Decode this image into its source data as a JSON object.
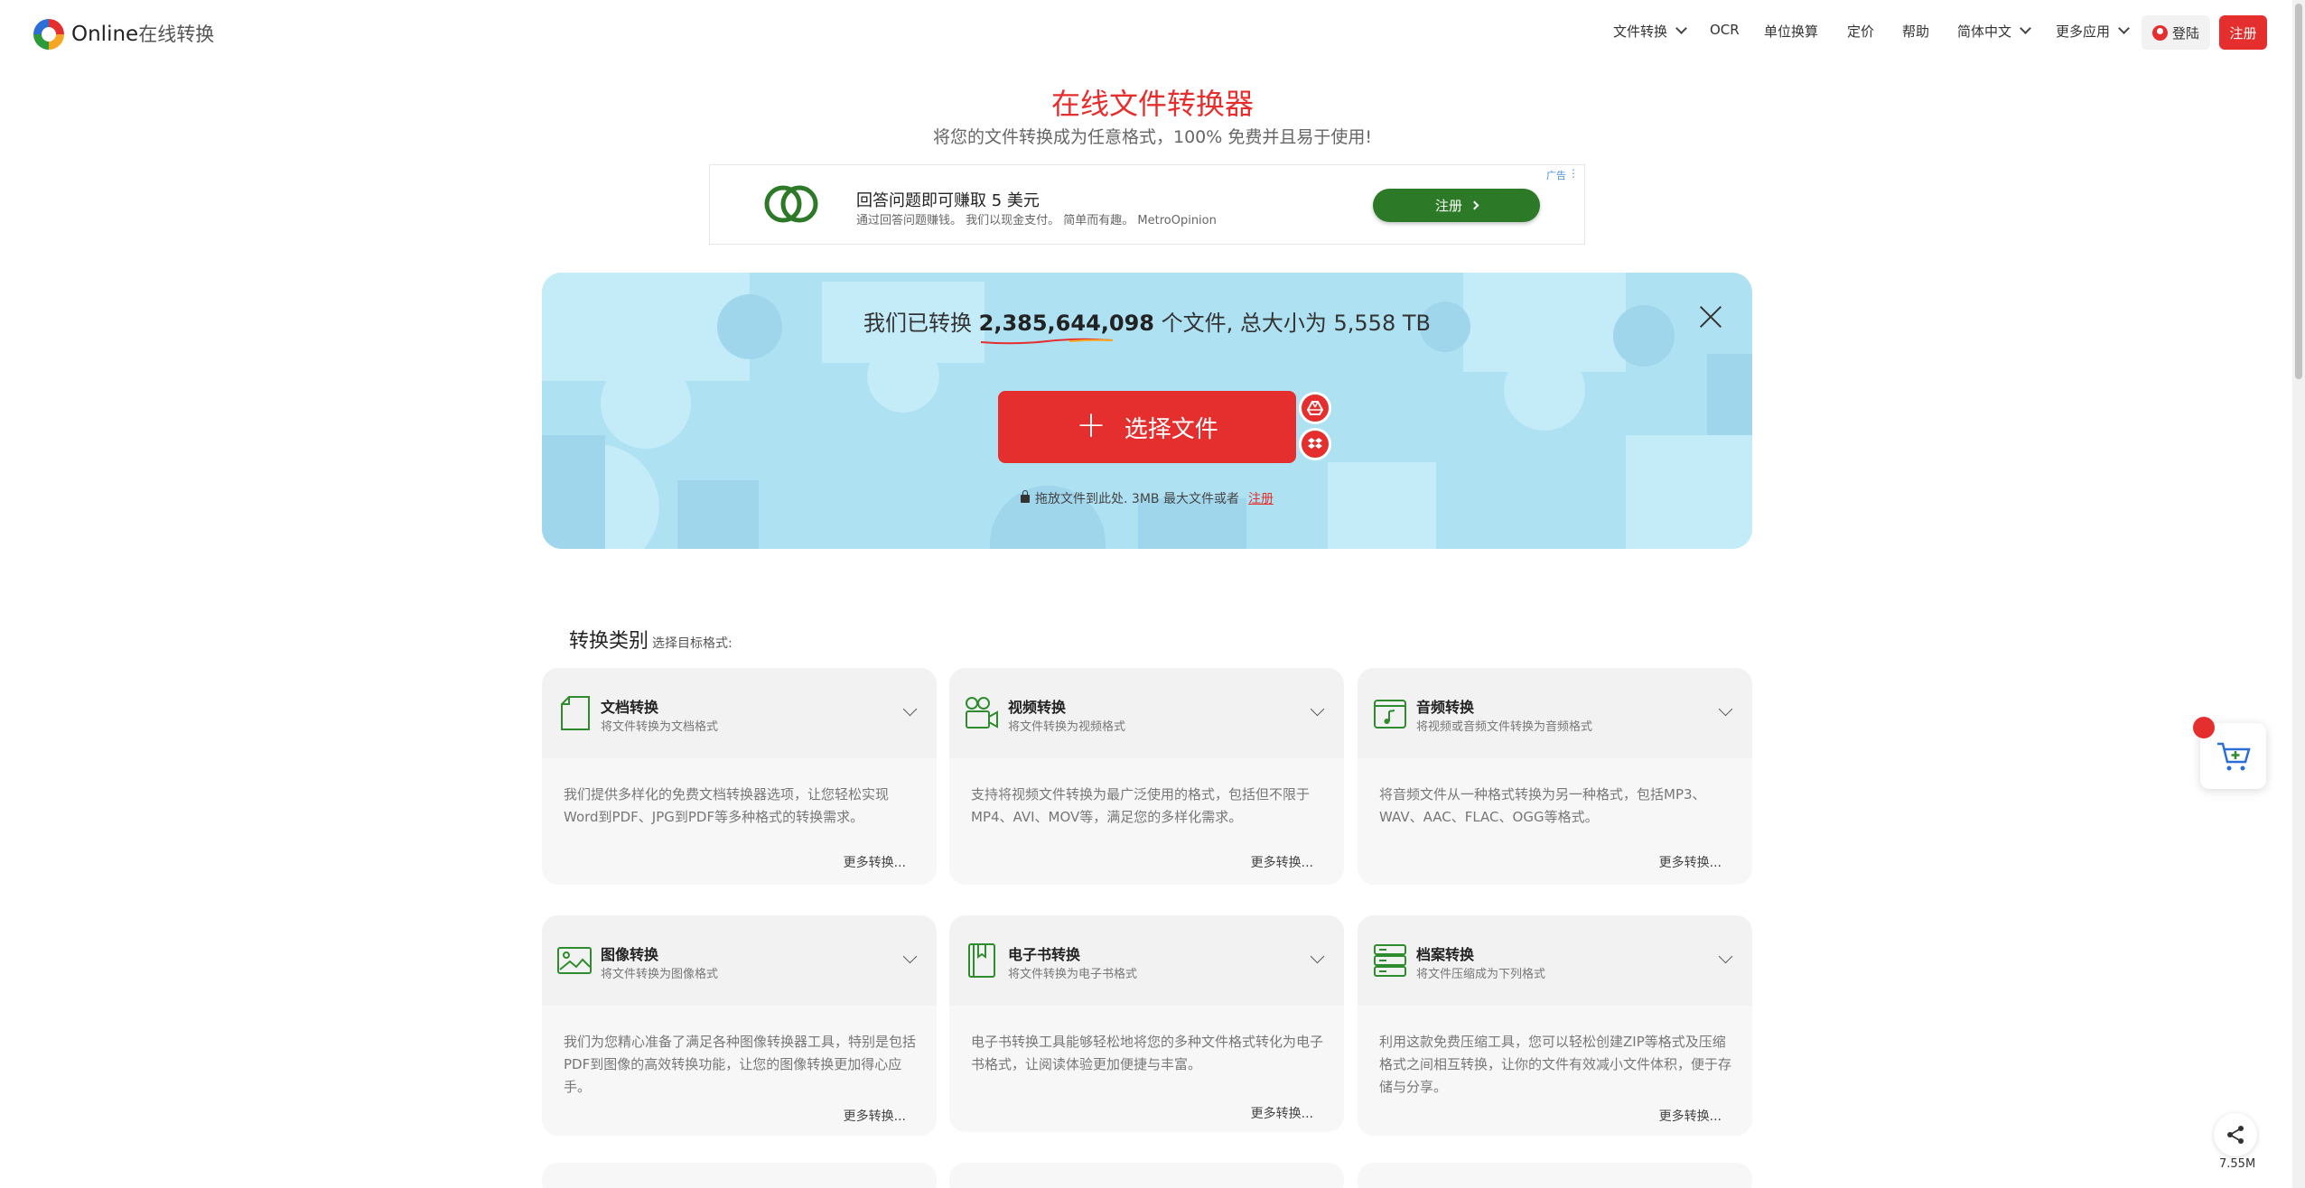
{
  "header": {
    "brand_main": "Online",
    "brand_sub": "在线转换",
    "nav": {
      "file_convert": "文件转换",
      "ocr": "OCR",
      "unit": "单位换算",
      "pricing": "定价",
      "help": "帮助",
      "language": "简体中文",
      "more_apps": "更多应用"
    },
    "login": "登陆",
    "register": "注册"
  },
  "hero": {
    "title": "在线文件转换器",
    "subtitle": "将您的文件转换成为任意格式，100% 免费并且易于使用!"
  },
  "ad": {
    "title": "回答问题即可赚取 5 美元",
    "desc": "通过回答问题赚钱。 我们以现金支付。 简单而有趣。 MetroOpinion",
    "button": "注册",
    "label": "广告"
  },
  "upload": {
    "stats_prefix": "我们已转换",
    "count": "2,385,644,098",
    "stats_suffix": "个文件, 总大小为 5,558 TB",
    "choose_button": "选择文件",
    "hint_text": "拖放文件到此处. 3MB 最大文件或者",
    "hint_link": "注册"
  },
  "categories": {
    "heading": "转换类别",
    "heading_small": "选择目标格式:",
    "more_label": "更多转换...",
    "items": [
      {
        "title": "文档转换",
        "sub": "将文件转换为文档格式",
        "desc": "我们提供多样化的免费文档转换器选项，让您轻松实现Word到PDF、JPG到PDF等多种格式的转换需求。"
      },
      {
        "title": "视频转换",
        "sub": "将文件转换为视频格式",
        "desc": "支持将视频文件转换为最广泛使用的格式，包括但不限于MP4、AVI、MOV等，满足您的多样化需求。"
      },
      {
        "title": "音频转换",
        "sub": "将视频或音频文件转换为音频格式",
        "desc": "将音频文件从一种格式转换为另一种格式，包括MP3、WAV、AAC、FLAC、OGG等格式。"
      },
      {
        "title": "图像转换",
        "sub": "将文件转换为图像格式",
        "desc": "我们为您精心准备了满足各种图像转换器工具，特别是包括PDF到图像的高效转换功能，让您的图像转换更加得心应手。"
      },
      {
        "title": "电子书转换",
        "sub": "将文件转换为电子书格式",
        "desc": "电子书转换工具能够轻松地将您的多种文件格式转化为电子书格式，让阅读体验更加便捷与丰富。"
      },
      {
        "title": "档案转换",
        "sub": "将文件压缩成为下列格式",
        "desc": "利用这款免费压缩工具，您可以轻松创建ZIP等格式及压缩格式之间相互转换，让你的文件有效减小文件体积，便于存储与分享。"
      }
    ]
  },
  "widgets": {
    "share_size": "7.55M"
  },
  "colors": {
    "accent": "#e52e2e",
    "icon_green": "#2e8b2e",
    "upload_bg": "#aee1f2",
    "ad_button": "#2c7a27"
  }
}
